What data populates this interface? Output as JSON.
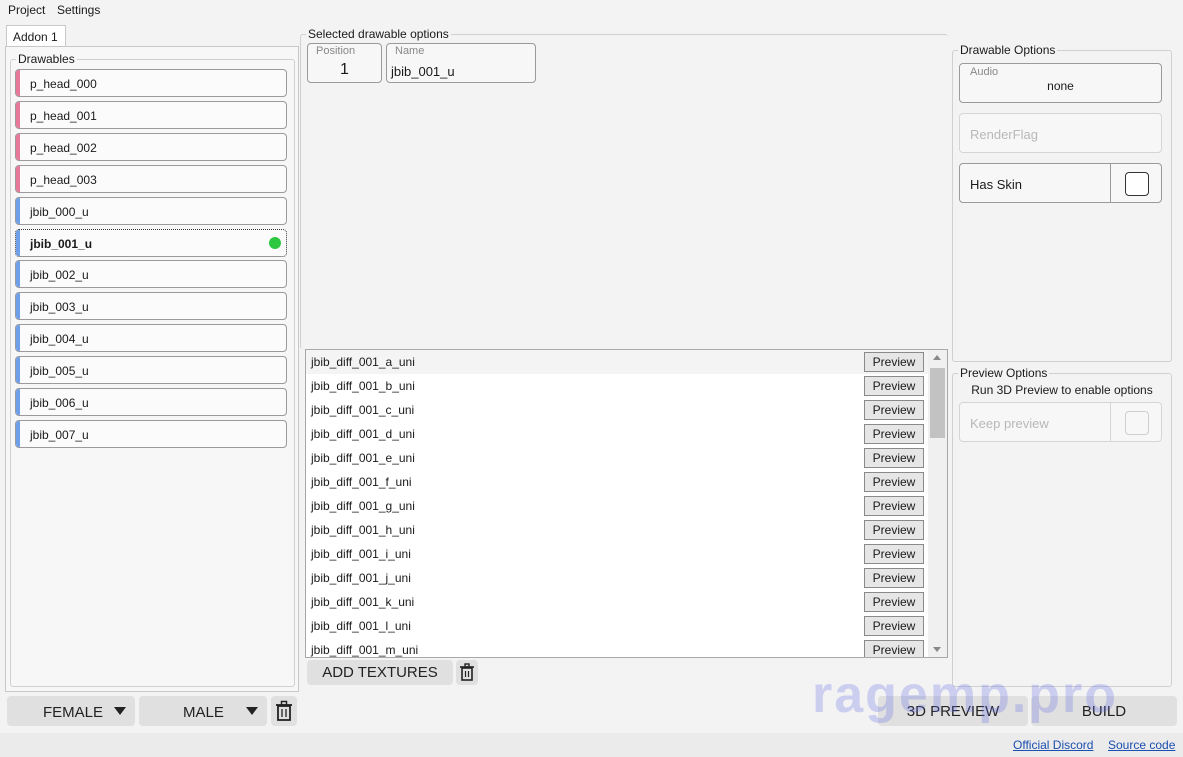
{
  "menu": [
    "Project",
    "Settings"
  ],
  "tab": "Addon 1",
  "drawables_label": "Drawables",
  "drawables": [
    {
      "name": "p_head_000",
      "color": "#e8789a",
      "selected": false
    },
    {
      "name": "p_head_001",
      "color": "#e8789a",
      "selected": false
    },
    {
      "name": "p_head_002",
      "color": "#e8789a",
      "selected": false
    },
    {
      "name": "p_head_003",
      "color": "#e8789a",
      "selected": false
    },
    {
      "name": "jbib_000_u",
      "color": "#6f9fe8",
      "selected": false
    },
    {
      "name": "jbib_001_u",
      "color": "#6f9fe8",
      "selected": true
    },
    {
      "name": "jbib_002_u",
      "color": "#6f9fe8",
      "selected": false
    },
    {
      "name": "jbib_003_u",
      "color": "#6f9fe8",
      "selected": false
    },
    {
      "name": "jbib_004_u",
      "color": "#6f9fe8",
      "selected": false
    },
    {
      "name": "jbib_005_u",
      "color": "#6f9fe8",
      "selected": false
    },
    {
      "name": "jbib_006_u",
      "color": "#6f9fe8",
      "selected": false
    },
    {
      "name": "jbib_007_u",
      "color": "#6f9fe8",
      "selected": false
    }
  ],
  "selected_options": {
    "label": "Selected drawable options",
    "position_caption": "Position",
    "position_value": "1",
    "name_caption": "Name",
    "name_value": "jbib_001_u"
  },
  "textures": [
    "jbib_diff_001_a_uni",
    "jbib_diff_001_b_uni",
    "jbib_diff_001_c_uni",
    "jbib_diff_001_d_uni",
    "jbib_diff_001_e_uni",
    "jbib_diff_001_f_uni",
    "jbib_diff_001_g_uni",
    "jbib_diff_001_h_uni",
    "jbib_diff_001_i_uni",
    "jbib_diff_001_j_uni",
    "jbib_diff_001_k_uni",
    "jbib_diff_001_l_uni",
    "jbib_diff_001_m_uni"
  ],
  "preview_label": "Preview",
  "add_textures_label": "ADD TEXTURES",
  "drawable_options": {
    "label": "Drawable Options",
    "audio_caption": "Audio",
    "audio_value": "none",
    "renderflag_placeholder": "RenderFlag",
    "has_skin_label": "Has Skin"
  },
  "preview_options": {
    "label": "Preview Options",
    "hint": "Run 3D Preview to enable options",
    "keep_preview_label": "Keep preview"
  },
  "bottom": {
    "female_label": "FEMALE",
    "male_label": "MALE",
    "preview3d_label": "3D PREVIEW",
    "build_label": "BUILD"
  },
  "footer": {
    "discord_link": "Official Discord",
    "source_link": "Source code"
  },
  "watermark": "ragemp.pro",
  "accent_selected_dot": "#2ec840"
}
